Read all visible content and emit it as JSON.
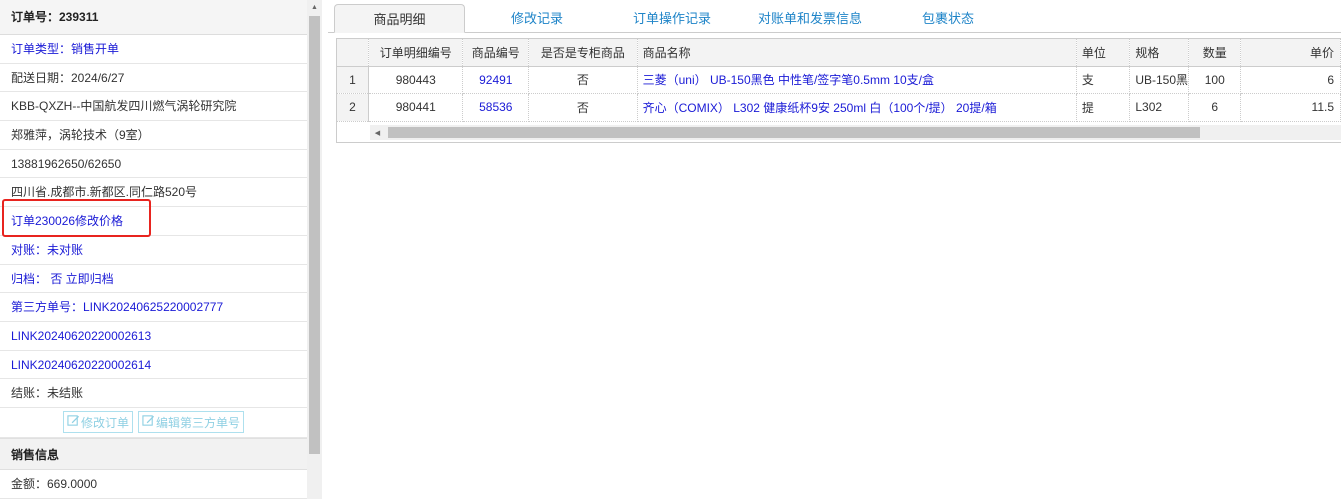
{
  "left": {
    "order_title": "订单号：239311",
    "rows": [
      {
        "name": "order-type",
        "text": "订单类型：销售开单",
        "blue": true
      },
      {
        "name": "delivery-date",
        "text": "配送日期：2024/6/27",
        "blue": false
      },
      {
        "name": "customer-name",
        "text": "KBB-QXZH--中国航发四川燃气涡轮研究院",
        "blue": false
      },
      {
        "name": "contact-person",
        "text": "郑雅萍，涡轮技术（9室）",
        "blue": false
      },
      {
        "name": "contact-phone",
        "text": "13881962650/62650",
        "blue": false
      },
      {
        "name": "delivery-address",
        "text": "四川省.成都市.新都区.同仁路520号",
        "blue": false
      },
      {
        "name": "order-remark-link",
        "text": "订单230026修改价格",
        "blue": true
      },
      {
        "name": "reconcile-status",
        "text": "对账：未对账",
        "blue": true
      },
      {
        "name": "archive-status",
        "text": "归档： 否 立即归档",
        "blue": true
      },
      {
        "name": "third-party-order",
        "text": "第三方单号：LINK20240625220002777",
        "blue": true
      },
      {
        "name": "third-party-order-2",
        "text": "LINK20240620220002613",
        "blue": true
      },
      {
        "name": "third-party-order-3",
        "text": "LINK20240620220002614",
        "blue": true
      },
      {
        "name": "settlement-status",
        "text": "结账：未结账",
        "blue": false
      }
    ],
    "edit_order_label": "修改订单",
    "edit_third_party_label": "编辑第三方单号",
    "sales_section_title": "销售信息",
    "amount_text": "金额：669.0000"
  },
  "tabs": [
    {
      "label": "商品明细",
      "active": true
    },
    {
      "label": "修改记录",
      "active": false
    },
    {
      "label": "订单操作记录",
      "active": false
    },
    {
      "label": "对账单和发票信息",
      "active": false
    },
    {
      "label": "包裹状态",
      "active": false
    }
  ],
  "grid": {
    "columns": [
      "",
      "订单明细编号",
      "商品编号",
      "是否是专柜商品",
      "商品名称",
      "单位",
      "规格",
      "数量",
      "单价"
    ],
    "rows": [
      [
        "1",
        "980443",
        "92491",
        "否",
        "三菱（uni） UB-150黑色 中性笔/签字笔0.5mm 10支/盒",
        "支",
        "UB-150黑",
        "100",
        "6"
      ],
      [
        "2",
        "980441",
        "58536",
        "否",
        "齐心（COMIX） L302 健康纸杯9安 250ml 白（100个/提） 20提/箱",
        "提",
        "L302",
        "6",
        "11.5"
      ]
    ]
  },
  "colors": {
    "link_blue": "#1a1ad6",
    "tab_blue": "#1e84c8",
    "highlight_red": "#e8241f"
  }
}
